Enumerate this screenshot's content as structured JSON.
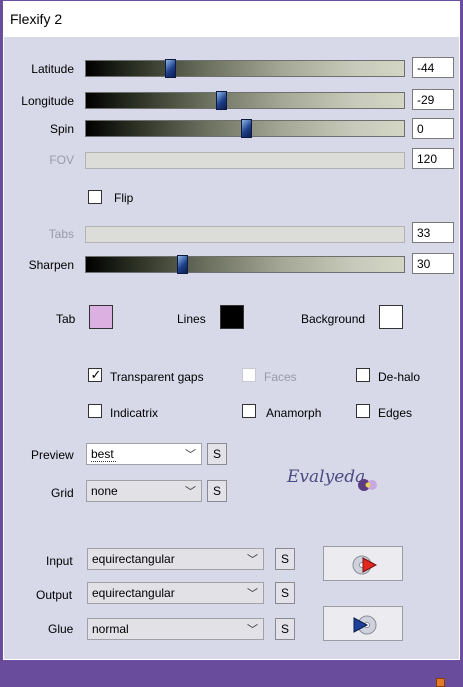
{
  "window": {
    "title": "Flexify 2"
  },
  "sliders": [
    {
      "key": "latitude",
      "label": "Latitude",
      "value": "-44",
      "enabled": true,
      "fraction": 0.26
    },
    {
      "key": "longitude",
      "label": "Longitude",
      "value": "-29",
      "enabled": true,
      "fraction": 0.42
    },
    {
      "key": "spin",
      "label": "Spin",
      "value": "0",
      "enabled": true,
      "fraction": 0.5
    },
    {
      "key": "fov",
      "label": "FOV",
      "value": "120",
      "enabled": false
    },
    {
      "key": "tabs",
      "label": "Tabs",
      "value": "33",
      "enabled": false
    },
    {
      "key": "sharpen",
      "label": "Sharpen",
      "value": "30",
      "enabled": true,
      "fraction": 0.3
    }
  ],
  "flip": {
    "label": "Flip",
    "checked": false
  },
  "colors": {
    "tab": {
      "label": "Tab",
      "color": "#dcb0e0"
    },
    "lines": {
      "label": "Lines",
      "color": "#000000"
    },
    "background": {
      "label": "Background",
      "color": "#ffffff"
    }
  },
  "options": {
    "transparent_gaps": {
      "label": "Transparent gaps",
      "checked": true
    },
    "faces": {
      "label": "Faces",
      "checked": false,
      "enabled": false
    },
    "de_halo": {
      "label": "De-halo",
      "checked": false
    },
    "indicatrix": {
      "label": "Indicatrix",
      "checked": false
    },
    "anamorph": {
      "label": "Anamorph",
      "checked": false
    },
    "edges": {
      "label": "Edges",
      "checked": false
    }
  },
  "preview": {
    "label": "Preview",
    "value": "best"
  },
  "grid": {
    "label": "Grid",
    "value": "none"
  },
  "input": {
    "label": "Input",
    "value": "equirectangular"
  },
  "output": {
    "label": "Output",
    "value": "equirectangular"
  },
  "glue": {
    "label": "Glue",
    "value": "normal"
  },
  "s_button_label": "S",
  "watermark": "Evalyeda",
  "icons": {
    "ok": "cd-play-icon",
    "cancel": "play-cd-icon",
    "resize": "resize-grip-icon"
  }
}
